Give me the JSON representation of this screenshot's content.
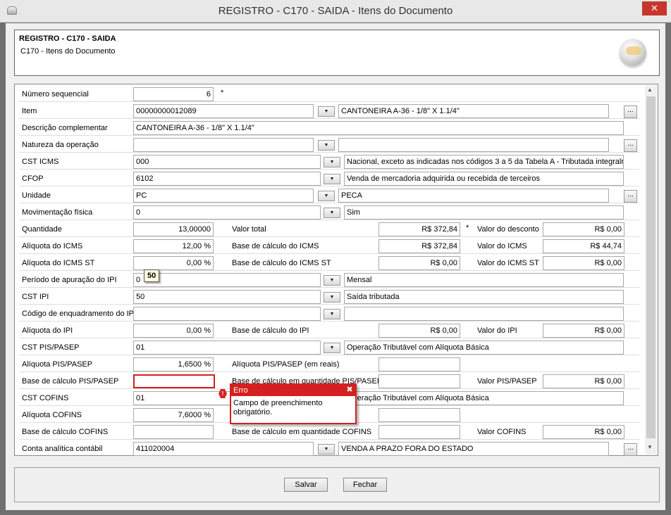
{
  "window": {
    "title": "REGISTRO - C170 - SAIDA - Itens do Documento"
  },
  "header": {
    "title": "REGISTRO - C170 - SAIDA",
    "subtitle": "C170 - Itens do Documento"
  },
  "fields": {
    "numero_sequencial": {
      "label": "Número sequencial",
      "value": "6",
      "required": "*"
    },
    "item": {
      "label": "Item",
      "code": "00000000012089",
      "desc": "CANTONEIRA A-36 - 1/8\" X 1.1/4\""
    },
    "descricao_complementar": {
      "label": "Descrição complementar",
      "value": "CANTONEIRA A-36 - 1/8\" X 1.1/4\""
    },
    "natureza_operacao": {
      "label": "Natureza da operação",
      "code": "",
      "desc": ""
    },
    "cst_icms": {
      "label": "CST ICMS",
      "code": "000",
      "desc": "Nacional, exceto as indicadas nos códigos 3 a 5 da Tabela A - Tributada integralr"
    },
    "cfop": {
      "label": "CFOP",
      "code": "6102",
      "desc": "Venda de mercadoria adquirida ou recebida de terceiros"
    },
    "unidade": {
      "label": "Unidade",
      "code": "PC",
      "desc": "PECA"
    },
    "movimentacao_fisica": {
      "label": "Movimentação física",
      "code": "0",
      "desc": "Sim"
    },
    "quantidade": {
      "label": "Quantidade",
      "value": "13,00000"
    },
    "valor_total": {
      "label": "Valor total",
      "value": "R$ 372,84",
      "required": "*"
    },
    "valor_desconto": {
      "label": "Valor do desconto",
      "value": "R$ 0,00"
    },
    "aliquota_icms": {
      "label": "Alíquota do ICMS",
      "value": "12,00 %"
    },
    "base_icms": {
      "label": "Base de cálculo do ICMS",
      "value": "R$ 372,84"
    },
    "valor_icms": {
      "label": "Valor do ICMS",
      "value": "R$ 44,74"
    },
    "aliquota_icms_st": {
      "label": "Alíquota do ICMS ST",
      "value": "0,00 %"
    },
    "base_icms_st": {
      "label": "Base de cálculo do ICMS ST",
      "value": "R$ 0,00"
    },
    "valor_icms_st": {
      "label": "Valor do ICMS ST",
      "value": "R$ 0,00"
    },
    "periodo_ipi": {
      "label": "Período de apuração do IPI",
      "code": "0",
      "desc": "Mensal"
    },
    "cst_ipi": {
      "label": "CST IPI",
      "code": "50",
      "desc": "Saída tributada"
    },
    "codigo_enquadramento_ipi": {
      "label": "Código de enquadramento do IPI",
      "code": "",
      "desc": "",
      "tooltip": "50"
    },
    "aliquota_ipi": {
      "label": "Alíquota do IPI",
      "value": "0,00 %"
    },
    "base_ipi": {
      "label": "Base de cálculo do IPI",
      "value": "R$ 0,00"
    },
    "valor_ipi": {
      "label": "Valor do IPI",
      "value": "R$ 0,00"
    },
    "cst_pis": {
      "label": "CST PIS/PASEP",
      "code": "01",
      "desc": "Operação Tributável com Alíquota Básica"
    },
    "aliquota_pis": {
      "label": "Alíquota PIS/PASEP",
      "value": "1,6500 %"
    },
    "aliquota_pis_reais": {
      "label": "Alíquota PIS/PASEP (em reais)",
      "value": ""
    },
    "base_pis": {
      "label": "Base de cálculo PIS/PASEP",
      "value": ""
    },
    "base_pis_qtd": {
      "label": "Base de cálculo em quantidade PIS/PASEP",
      "value": ""
    },
    "valor_pis": {
      "label": "Valor PIS/PASEP",
      "value": "R$ 0,00"
    },
    "cst_cofins": {
      "label": "CST COFINS",
      "code": "01",
      "desc": "Operação Tributável com Alíquota Básica"
    },
    "aliquota_cofins": {
      "label": "Alíquota COFINS",
      "value": "7,6000 %"
    },
    "aliquota_cofins_reais": {
      "value": ""
    },
    "base_cofins": {
      "label": "Base de cálculo COFINS",
      "value": ""
    },
    "base_cofins_qtd": {
      "label": "Base de cálculo em quantidade COFINS",
      "value": ""
    },
    "valor_cofins": {
      "label": "Valor COFINS",
      "value": "R$ 0,00"
    },
    "conta_analitica": {
      "label": "Conta analítica contábil",
      "code": "411020004",
      "desc": "VENDA A PRAZO FORA DO ESTADO"
    }
  },
  "error_popup": {
    "title": "Erro",
    "message": "Campo de preenchimento obrigatório."
  },
  "footer": {
    "save_label": "Salvar",
    "close_label": "Fechar"
  },
  "colors": {
    "error": "#d42020",
    "title_bar": "#e8e8e8",
    "close": "#c7362d"
  }
}
